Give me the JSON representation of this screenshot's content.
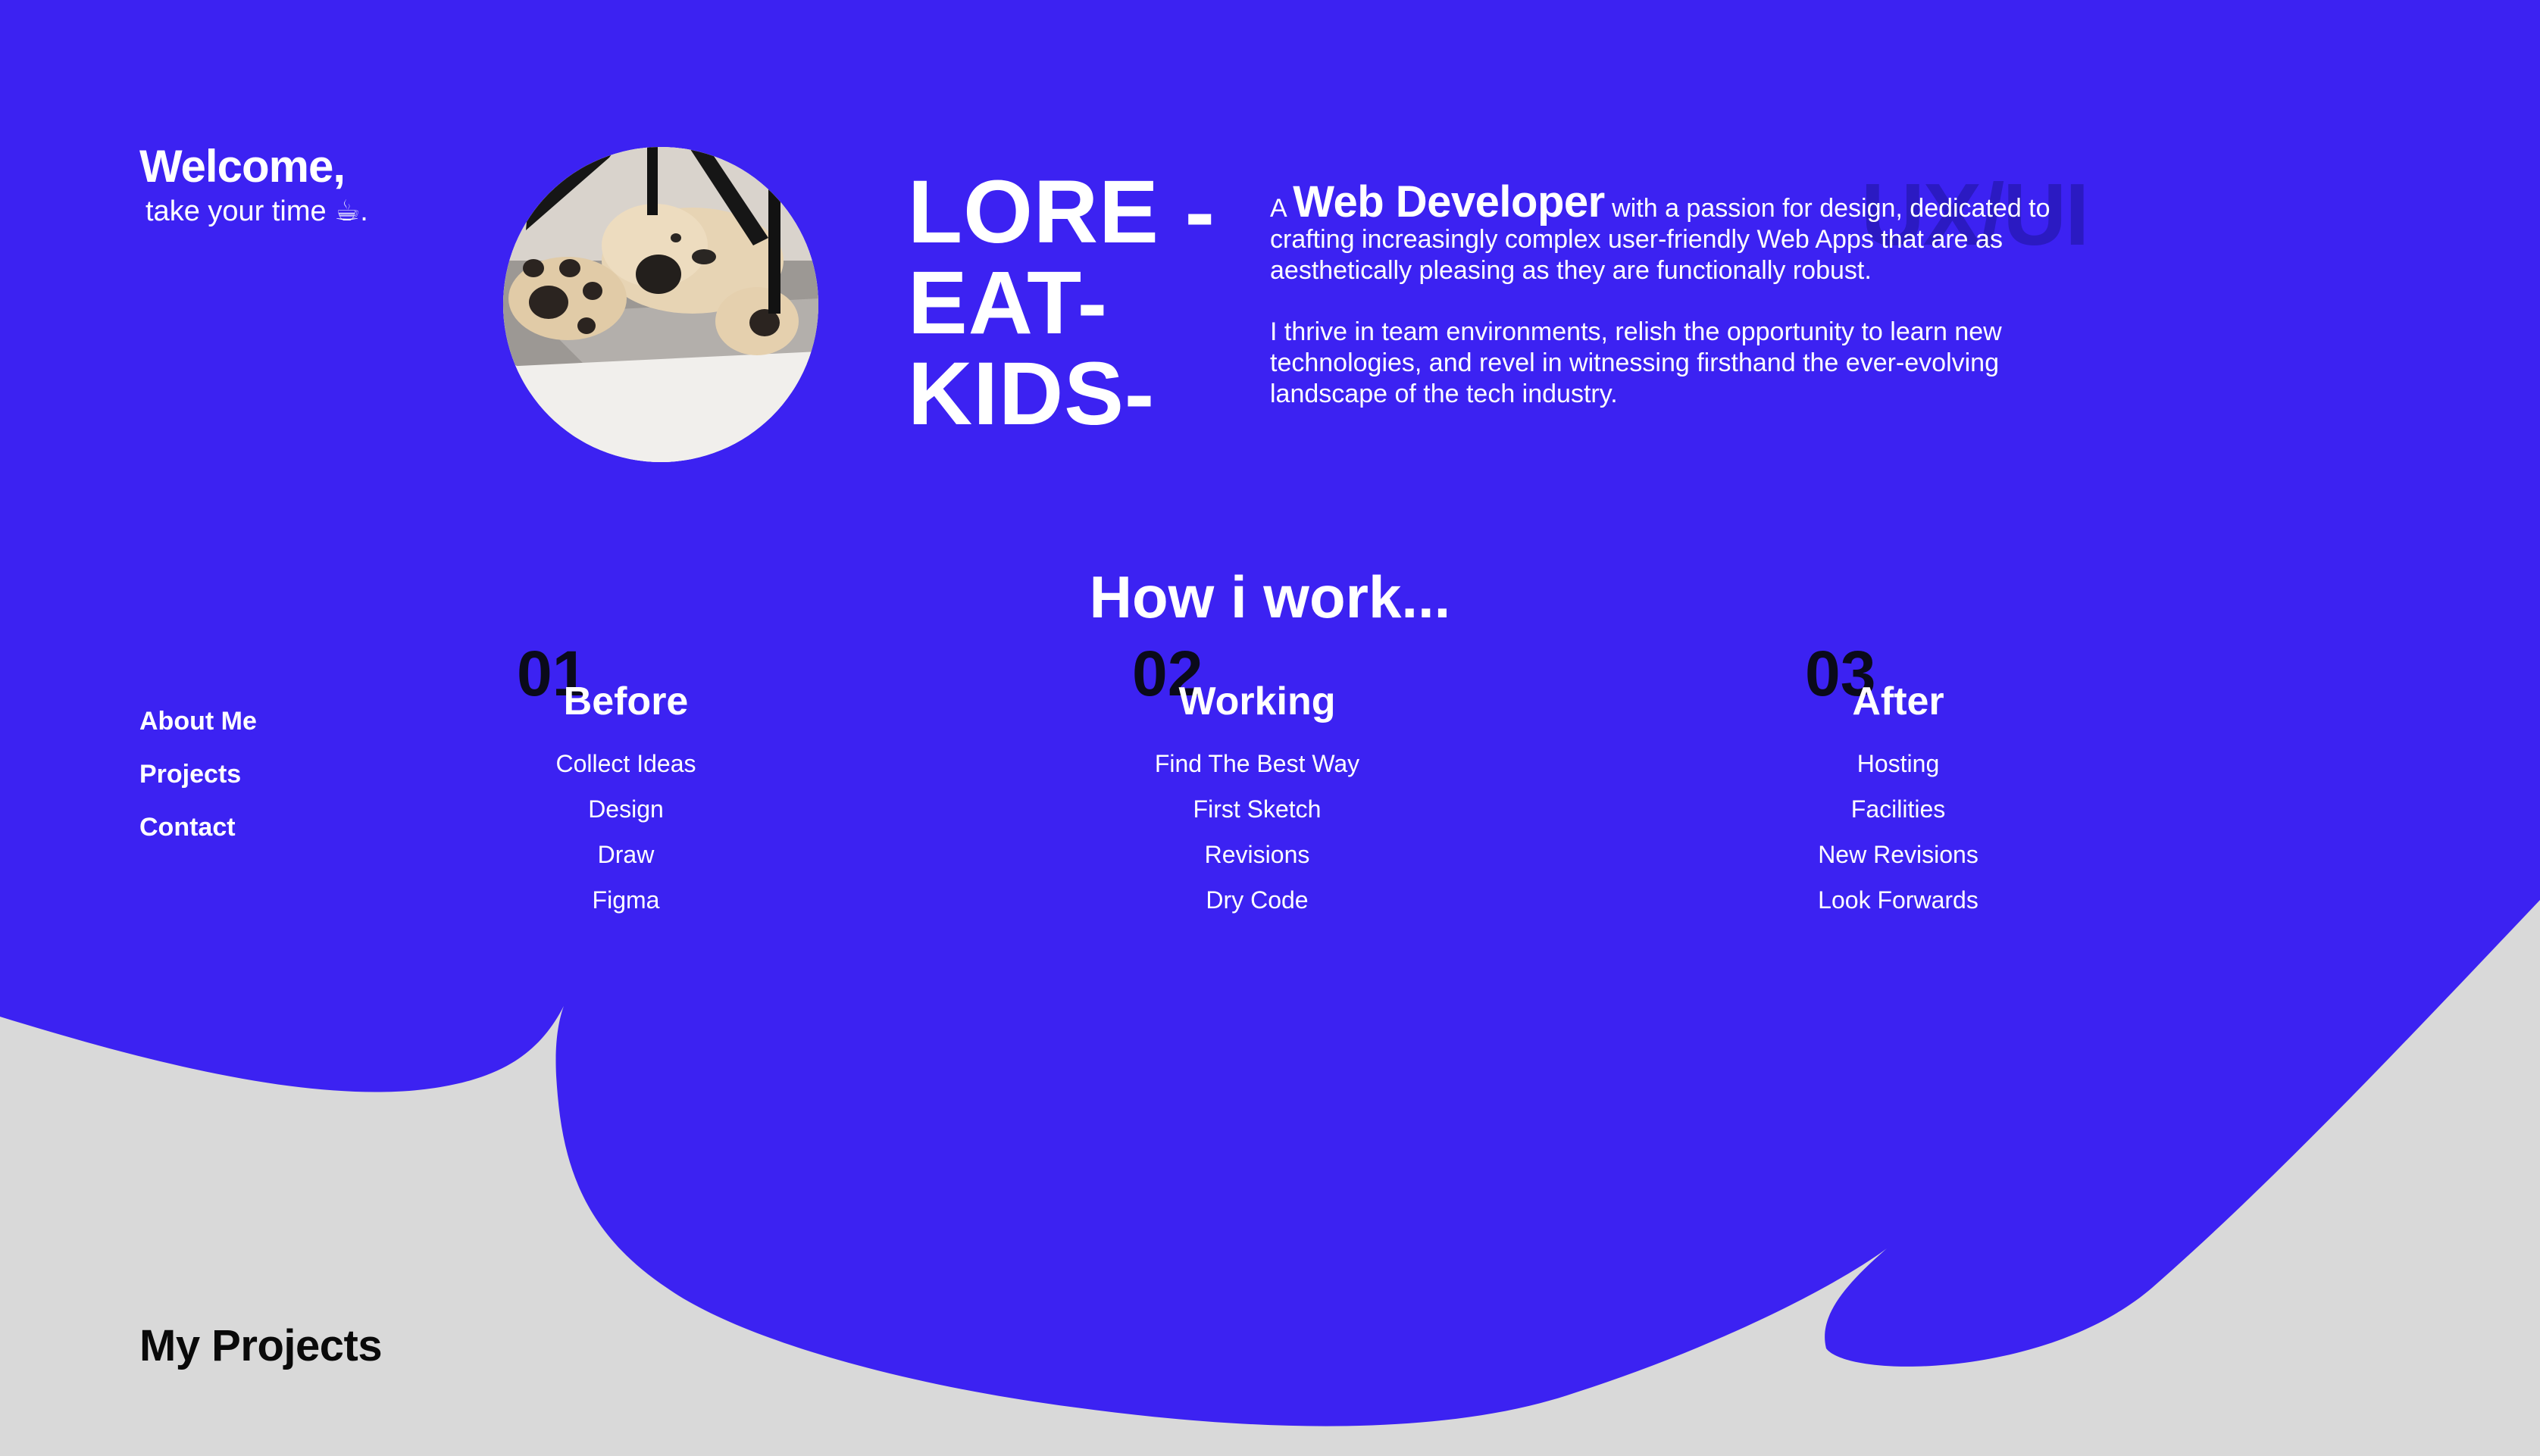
{
  "colors": {
    "primary_blue": "#3c22f2",
    "background_gray": "#d9d9d9",
    "text_white": "#ffffff",
    "number_dark": "#0a0a1a",
    "watermark": "#2b1ac2"
  },
  "welcome": {
    "title": "Welcome,",
    "subtitle": "take your time ☕."
  },
  "avatar": {
    "icon": "dog-photo"
  },
  "hero": {
    "name": "LORE - EAT- KIDS-",
    "watermark": "UX/UI"
  },
  "intro": {
    "prefix": "A",
    "role": "Web Developer",
    "sentence_rest": "with a passion for design, dedicated to crafting increasingly complex user-friendly Web Apps that are as aesthetically pleasing as they are functionally robust.",
    "paragraph2": "I thrive in team environments, relish the opportunity to learn new technologies, and revel in witnessing firsthand the ever-evolving landscape of the tech industry."
  },
  "nav": {
    "items": [
      {
        "label": "About Me"
      },
      {
        "label": "Projects"
      },
      {
        "label": "Contact"
      }
    ]
  },
  "how": {
    "title": "How i work...",
    "steps": [
      {
        "number": "01",
        "title": "Before",
        "items": [
          "Collect Ideas",
          "Design",
          "Draw",
          "Figma"
        ]
      },
      {
        "number": "02",
        "title": "Working",
        "items": [
          "Find The Best Way",
          "First Sketch",
          "Revisions",
          "Dry Code"
        ]
      },
      {
        "number": "03",
        "title": "After",
        "items": [
          "Hosting",
          "Facilities",
          "New Revisions",
          "Look Forwards"
        ]
      }
    ]
  },
  "projects": {
    "heading": "My Projects"
  }
}
